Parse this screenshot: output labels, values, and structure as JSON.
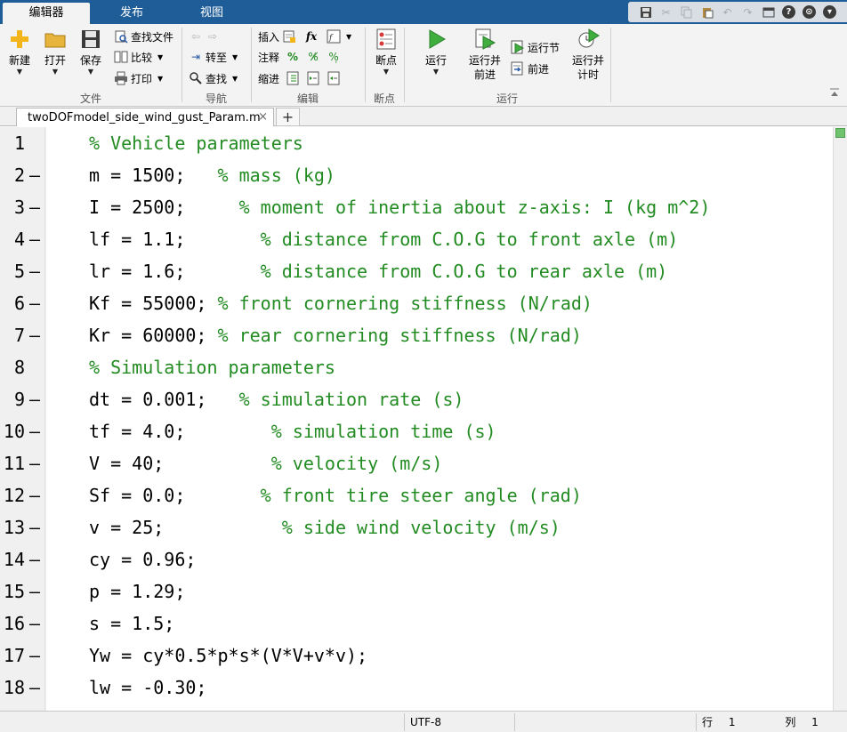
{
  "tabs": [
    {
      "label": "编辑器",
      "active": true
    },
    {
      "label": "发布",
      "active": false
    },
    {
      "label": "视图",
      "active": false
    }
  ],
  "ribbon": {
    "file": {
      "new": "新建",
      "open": "打开",
      "save": "保存",
      "find_files": "查找文件",
      "compare": "比较",
      "print": "打印",
      "group": "文件"
    },
    "navigate": {
      "goto": "转至",
      "find": "查找",
      "group": "导航"
    },
    "edit": {
      "insert": "插入",
      "comment": "注释",
      "indent": "缩进",
      "fx": "fx",
      "group": "编辑"
    },
    "breakpoints": {
      "breakpoint": "断点",
      "group": "断点"
    },
    "run": {
      "run": "运行",
      "run_advance_1": "运行并",
      "run_advance_2": "前进",
      "run_section": "运行节",
      "advance": "前进",
      "run_time_1": "运行并",
      "run_time_2": "计时",
      "group": "运行"
    }
  },
  "file_tab": {
    "name": "twoDOFmodel_side_wind_gust_Param.m",
    "add": "+"
  },
  "code_lines": [
    {
      "n": "1",
      "dash": "",
      "code": "",
      "comment": "% Vehicle parameters"
    },
    {
      "n": "2",
      "dash": "—",
      "code": "m = 1500;   ",
      "comment": "% mass (kg)"
    },
    {
      "n": "3",
      "dash": "—",
      "code": "I = 2500;     ",
      "comment": "% moment of inertia about z-axis: I (kg m^2)"
    },
    {
      "n": "4",
      "dash": "—",
      "code": "lf = 1.1;       ",
      "comment": "% distance from C.O.G to front axle (m)"
    },
    {
      "n": "5",
      "dash": "—",
      "code": "lr = 1.6;       ",
      "comment": "% distance from C.O.G to rear axle (m)"
    },
    {
      "n": "6",
      "dash": "—",
      "code": "Kf = 55000; ",
      "comment": "% front cornering stiffness (N/rad)"
    },
    {
      "n": "7",
      "dash": "—",
      "code": "Kr = 60000; ",
      "comment": "% rear cornering stiffness (N/rad)"
    },
    {
      "n": "8",
      "dash": "",
      "code": "",
      "comment": "% Simulation parameters"
    },
    {
      "n": "9",
      "dash": "—",
      "code": "dt = 0.001;   ",
      "comment": "% simulation rate (s)"
    },
    {
      "n": "10",
      "dash": "—",
      "code": "tf = 4.0;        ",
      "comment": "% simulation time (s)"
    },
    {
      "n": "11",
      "dash": "—",
      "code": "V = 40;          ",
      "comment": "% velocity (m/s)"
    },
    {
      "n": "12",
      "dash": "—",
      "code": "Sf = 0.0;       ",
      "comment": "% front tire steer angle (rad)"
    },
    {
      "n": "13",
      "dash": "—",
      "code": "v = 25;           ",
      "comment": "% side wind velocity (m/s)"
    },
    {
      "n": "14",
      "dash": "—",
      "code": "cy = 0.96;",
      "comment": ""
    },
    {
      "n": "15",
      "dash": "—",
      "code": "p = 1.29;",
      "comment": ""
    },
    {
      "n": "16",
      "dash": "—",
      "code": "s = 1.5;",
      "comment": ""
    },
    {
      "n": "17",
      "dash": "—",
      "code": "Yw = cy*0.5*p*s*(V*V+v*v);",
      "comment": ""
    },
    {
      "n": "18",
      "dash": "—",
      "code": "lw = -0.30;",
      "comment": ""
    }
  ],
  "status": {
    "encoding": "UTF-8",
    "row_label": "行",
    "row": "1",
    "col_label": "列",
    "col": "1"
  }
}
